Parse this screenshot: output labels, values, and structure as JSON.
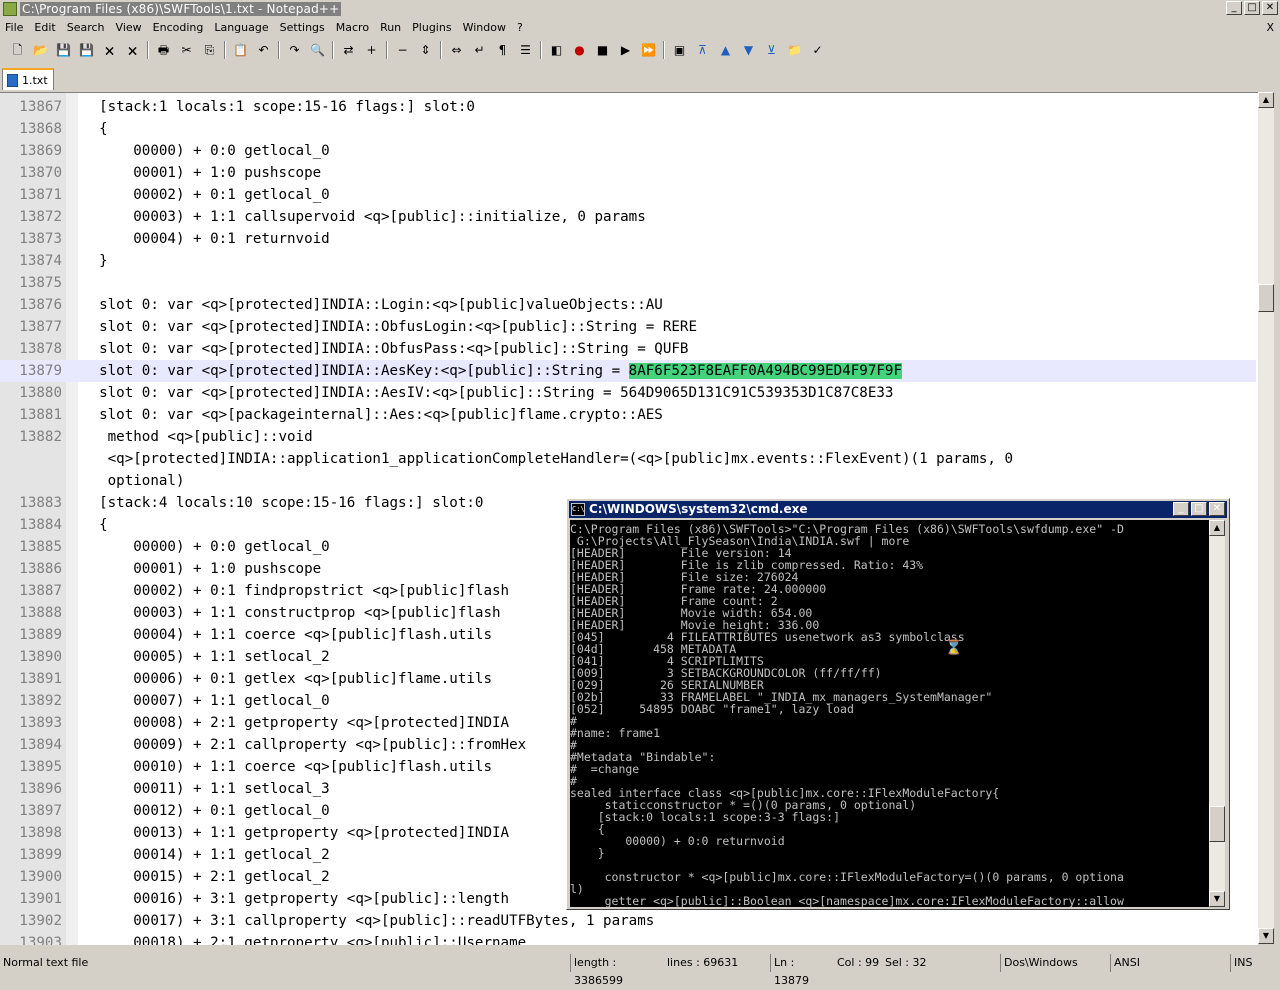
{
  "window": {
    "title": "C:\\Program Files (x86)\\SWFTools\\1.txt - Notepad++",
    "minimize": "_",
    "maximize": "□",
    "close": "✕"
  },
  "menu": {
    "items": [
      "File",
      "Edit",
      "Search",
      "View",
      "Encoding",
      "Language",
      "Settings",
      "Macro",
      "Run",
      "Plugins",
      "Window",
      "?"
    ],
    "close_glyph": "X"
  },
  "toolbar": {
    "icons": [
      "new-file-icon",
      "open-file-icon",
      "save-icon",
      "save-all-icon",
      "close-icon",
      "close-all-icon",
      "print-icon",
      "cut-icon",
      "copy-icon",
      "paste-icon",
      "undo-icon",
      "redo-icon",
      "find-icon",
      "replace-icon",
      "zoom-in-icon",
      "zoom-out-icon",
      "sync-vertical-icon",
      "sync-horizontal-icon",
      "word-wrap-icon",
      "show-all-chars-icon",
      "indent-guide-icon",
      "user-lang-icon",
      "record-macro-icon",
      "stop-record-icon",
      "play-macro-icon",
      "run-macro-multiple-icon",
      "save-macro-icon",
      "fold-all-icon",
      "prev-bookmark-icon",
      "next-bookmark-icon",
      "unfold-all-icon",
      "open-folder-icon",
      "spellcheck-icon"
    ],
    "accent": "#c00000"
  },
  "tab": {
    "label": "1.txt"
  },
  "editor": {
    "lines": [
      {
        "n": "13867",
        "t": "  [stack:1 locals:1 scope:15-16 flags:] slot:0"
      },
      {
        "n": "13868",
        "t": "  {"
      },
      {
        "n": "13869",
        "t": "      00000) + 0:0 getlocal_0"
      },
      {
        "n": "13870",
        "t": "      00001) + 1:0 pushscope"
      },
      {
        "n": "13871",
        "t": "      00002) + 0:1 getlocal_0"
      },
      {
        "n": "13872",
        "t": "      00003) + 1:1 callsupervoid <q>[public]::initialize, 0 params"
      },
      {
        "n": "13873",
        "t": "      00004) + 0:1 returnvoid"
      },
      {
        "n": "13874",
        "t": "  }"
      },
      {
        "n": "13875",
        "t": ""
      },
      {
        "n": "13876",
        "t": "  slot 0: var <q>[protected]INDIA::Login:<q>[public]valueObjects::AU"
      },
      {
        "n": "13877",
        "t": "  slot 0: var <q>[protected]INDIA::ObfusLogin:<q>[public]::String = RERE"
      },
      {
        "n": "13878",
        "t": "  slot 0: var <q>[protected]INDIA::ObfusPass:<q>[public]::String = QUFB"
      },
      {
        "n": "13879",
        "t": "  slot 0: var <q>[protected]INDIA::AesKey:<q>[public]::String = ",
        "h": "8AF6F523F8EAFF0A494BC99ED4F97F9F"
      },
      {
        "n": "13880",
        "t": "  slot 0: var <q>[protected]INDIA::AesIV:<q>[public]::String = 564D9065D131C91C539353D1C87C8E33"
      },
      {
        "n": "13881",
        "t": "  slot 0: var <q>[packageinternal]::Aes:<q>[public]flame.crypto::AES"
      },
      {
        "n": "13882",
        "t": "   method <q>[public]::void"
      },
      {
        "n": "",
        "t": "   <q>[protected]INDIA::application1_applicationCompleteHandler=(<q>[public]mx.events::FlexEvent)(1 params, 0"
      },
      {
        "n": "",
        "t": "   optional)"
      },
      {
        "n": "13883",
        "t": "  [stack:4 locals:10 scope:15-16 flags:] slot:0"
      },
      {
        "n": "13884",
        "t": "  {"
      },
      {
        "n": "13885",
        "t": "      00000) + 0:0 getlocal_0"
      },
      {
        "n": "13886",
        "t": "      00001) + 1:0 pushscope"
      },
      {
        "n": "13887",
        "t": "      00002) + 0:1 findpropstrict <q>[public]flash"
      },
      {
        "n": "13888",
        "t": "      00003) + 1:1 constructprop <q>[public]flash"
      },
      {
        "n": "13889",
        "t": "      00004) + 1:1 coerce <q>[public]flash.utils"
      },
      {
        "n": "13890",
        "t": "      00005) + 1:1 setlocal_2"
      },
      {
        "n": "13891",
        "t": "      00006) + 0:1 getlex <q>[public]flame.utils"
      },
      {
        "n": "13892",
        "t": "      00007) + 1:1 getlocal_0"
      },
      {
        "n": "13893",
        "t": "      00008) + 2:1 getproperty <q>[protected]INDIA"
      },
      {
        "n": "13894",
        "t": "      00009) + 2:1 callproperty <q>[public]::fromHex"
      },
      {
        "n": "13895",
        "t": "      00010) + 1:1 coerce <q>[public]flash.utils"
      },
      {
        "n": "13896",
        "t": "      00011) + 1:1 setlocal_3"
      },
      {
        "n": "13897",
        "t": "      00012) + 0:1 getlocal_0"
      },
      {
        "n": "13898",
        "t": "      00013) + 1:1 getproperty <q>[protected]INDIA"
      },
      {
        "n": "13899",
        "t": "      00014) + 1:1 getlocal_2"
      },
      {
        "n": "13900",
        "t": "      00015) + 2:1 getlocal_2"
      },
      {
        "n": "13901",
        "t": "      00016) + 3:1 getproperty <q>[public]::length"
      },
      {
        "n": "13902",
        "t": "      00017) + 3:1 callproperty <q>[public]::readUTFBytes, 1 params"
      },
      {
        "n": "13903",
        "t": "      00018) + 2:1 getproperty <q>[public]::Username"
      }
    ],
    "highlight_color": "#44d27a",
    "current_line": "13879"
  },
  "cmd": {
    "title": "C:\\WINDOWS\\system32\\cmd.exe",
    "icon_text": "C:\\",
    "lines": [
      "C:\\Program Files (x86)\\SWFTools>\"C:\\Program Files (x86)\\SWFTools\\swfdump.exe\" -D",
      " G:\\Projects\\All_FlySeason\\India\\INDIA.swf | more",
      "[HEADER]        File version: 14",
      "[HEADER]        File is zlib compressed. Ratio: 43%",
      "[HEADER]        File size: 276024",
      "[HEADER]        Frame rate: 24.000000",
      "[HEADER]        Frame count: 2",
      "[HEADER]        Movie width: 654.00",
      "[HEADER]        Movie height: 336.00",
      "[045]         4 FILEATTRIBUTES usenetwork as3 symbolclass",
      "[04d]       458 METADATA",
      "[041]         4 SCRIPTLIMITS",
      "[009]         3 SETBACKGROUNDCOLOR (ff/ff/ff)",
      "[029]        26 SERIALNUMBER",
      "[02b]        33 FRAMELABEL \"_INDIA_mx_managers_SystemManager\"",
      "[052]     54895 DOABC \"frame1\", lazy load",
      "#",
      "#name: frame1",
      "#",
      "#Metadata \"Bindable\":",
      "#  =change",
      "#",
      "sealed interface class <q>[public]mx.core::IFlexModuleFactory{",
      "     staticconstructor * =()(0 params, 0 optional)",
      "    [stack:0 locals:1 scope:3-3 flags:]",
      "    {",
      "        00000) + 0:0 returnvoid",
      "    }",
      "",
      "     constructor * <q>[public]mx.core::IFlexModuleFactory=()(0 params, 0 optiona",
      "l)",
      "     getter <q>[public]::Boolean <q>[namespace]mx.core:IFlexModuleFactory::allow"
    ],
    "cursor_glyph": "⌛"
  },
  "status": {
    "type": "Normal text file",
    "length": "length : 3386599",
    "lines": "lines : 69631",
    "ln": "Ln : 13879",
    "col": "Col : 99",
    "sel": "Sel : 32",
    "eol": "Dos\\Windows",
    "encoding": "ANSI",
    "mode": "INS"
  }
}
